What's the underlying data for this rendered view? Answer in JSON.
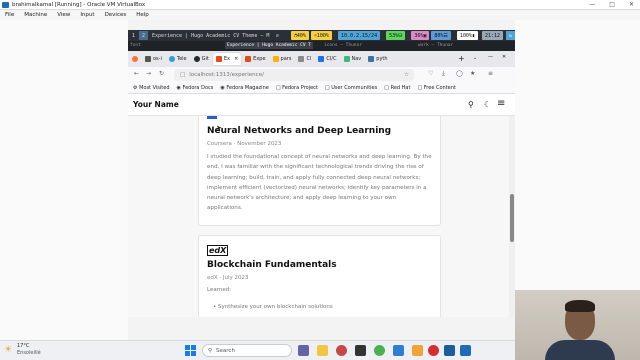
{
  "vbox": {
    "title": "brahimalkamal [Running] - Oracle VM VirtualBox",
    "menu": [
      "File",
      "Machine",
      "View",
      "Input",
      "Devices",
      "Help"
    ]
  },
  "guest_bar": {
    "workspaces": [
      "1",
      "2"
    ],
    "window_title": "Experience | Hugo Academic CV Theme — M",
    "status": {
      "volume": "40%",
      "brightness": "100%",
      "ip": "10.0.2.15/24",
      "disk": "53%",
      "cpu": "36%",
      "mem": "80%",
      "battery": "100%",
      "time": "21:12"
    },
    "sub_items": [
      "font",
      "Experience | Hugo Academic CV T",
      "icons — Thunar",
      "work — Thunar"
    ]
  },
  "firefox": {
    "tabs": [
      {
        "label": "",
        "color": "#ff7139"
      },
      {
        "label": "os-i",
        "color": "#555555"
      },
      {
        "label": "Tele",
        "color": "#2aa1da"
      },
      {
        "label": "Git",
        "color": "#24292e"
      },
      {
        "label": "Ex",
        "color": "#e64a19",
        "active": true
      },
      {
        "label": "Expe",
        "color": "#e64a19"
      },
      {
        "label": "pars",
        "color": "#ffb000"
      },
      {
        "label": "Cl",
        "color": "#8a8a8a"
      },
      {
        "label": "CI/C",
        "color": "#1a73e8"
      },
      {
        "label": "Nav",
        "color": "#41b883"
      },
      {
        "label": "pyth",
        "color": "#3776ab"
      }
    ],
    "url": "localhost:1313/experience/",
    "bookmarks": [
      "Most Visited",
      "Fedora Docs",
      "Fedora Magazine",
      "Fedora Project",
      "User Communities",
      "Red Hat",
      "Free Content"
    ]
  },
  "site": {
    "brand": "Your Name"
  },
  "cards": [
    {
      "title": "Neural Networks and Deep Learning",
      "meta": "Coursera · November 2023",
      "body": "I studied the foundational concept of neural networks and deep learning. By the end, I was familiar with the significant technological trends driving the rise of deep learning; build, train, and apply fully connected deep neural networks; implement efficient (vectorized) neural networks; identify key parameters in a neural network's architecture; and apply deep learning to your own applications."
    },
    {
      "logo": "edX",
      "title": "Blockchain Fundamentals",
      "meta": "edX · July 2023",
      "learned_label": "Learned:",
      "bullet": "Synthesize your own blockchain solutions"
    }
  ],
  "taskbar": {
    "weather_temp": "17°C",
    "weather_desc": "Ensoleillé",
    "search_placeholder": "Search"
  },
  "colors": {
    "guest_bar_bg": "#2b2f36",
    "volume_pill": "#f5d142",
    "ip_pill": "#4fa3d9",
    "disk_pill": "#5cd65c",
    "cpu_pill": "#d98ac9",
    "mem_pill": "#5b9bd5",
    "battery_pill": "#ffffff",
    "time_pill": "#9aa8b5"
  }
}
